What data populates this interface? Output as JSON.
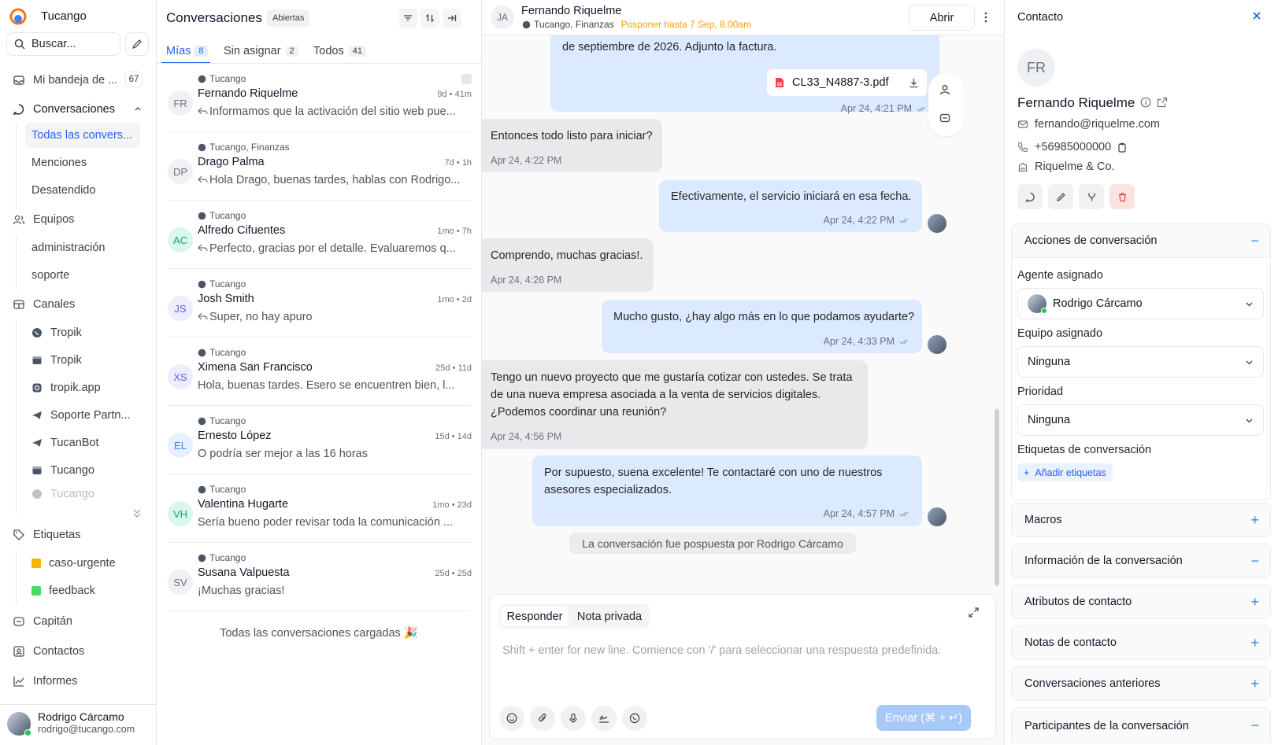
{
  "sidebar": {
    "brand": "Tucango",
    "search_placeholder": "Buscar...",
    "inbox": {
      "label": "Mi bandeja de ...",
      "count": "67"
    },
    "conversations": {
      "label": "Conversaciones",
      "items": [
        "Todas las convers...",
        "Menciones",
        "Desatendido"
      ]
    },
    "teams": {
      "label": "Equipos",
      "items": [
        "administración",
        "soporte"
      ]
    },
    "channels": {
      "label": "Canales",
      "items": [
        "Tropik",
        "Tropik",
        "tropik.app",
        "Soporte Partn...",
        "TucanBot",
        "Tucango",
        "Tucango"
      ]
    },
    "labels": {
      "label": "Etiquetas",
      "items": [
        {
          "name": "caso-urgente",
          "color": "#f5b400"
        },
        {
          "name": "feedback",
          "color": "#4cd964"
        }
      ]
    },
    "captain": "Capitán",
    "contacts": "Contactos",
    "reports": "Informes",
    "user": {
      "name": "Rodrigo Cárcamo",
      "email": "rodrigo@tucango.com"
    }
  },
  "list": {
    "title": "Conversaciones",
    "status_badge": "Abiertas",
    "tabs": [
      {
        "label": "Mías",
        "count": "8"
      },
      {
        "label": "Sin asignar",
        "count": "2"
      },
      {
        "label": "Todos",
        "count": "41"
      }
    ],
    "conversations": [
      {
        "initials": "FR",
        "inbox": "Tucango",
        "name": "Fernando Riquelme",
        "time": "9d • 41m",
        "preview": "Informamos que la activación del sitio web pue...",
        "reply": true,
        "avatar_bg": "#f1f1f3",
        "avatar_fg": "#6b7280"
      },
      {
        "initials": "DP",
        "inbox": "Tucango, Finanzas",
        "name": "Drago Palma",
        "time": "7d • 1h",
        "preview": "Hola Drago, buenas tardes, hablas con Rodrigo...",
        "reply": true,
        "avatar_bg": "#f1f1f3",
        "avatar_fg": "#6b7280"
      },
      {
        "initials": "AC",
        "inbox": "Tucango",
        "name": "Alfredo Cifuentes",
        "time": "1mo • 7h",
        "preview": "Perfecto, gracias por el detalle. Evaluaremos q...",
        "reply": true,
        "avatar_bg": "#d9f7ec",
        "avatar_fg": "#16a37b"
      },
      {
        "initials": "JS",
        "inbox": "Tucango",
        "name": "Josh Smith",
        "time": "1mo • 2d",
        "preview": "Super, no hay apuro",
        "reply": true,
        "avatar_bg": "#eceefe",
        "avatar_fg": "#5b63d3"
      },
      {
        "initials": "XS",
        "inbox": "Tucango",
        "name": "Ximena San Francisco",
        "time": "25d • 11d",
        "preview": "Hola, buenas tardes. Esero se encuentren bien, l...",
        "reply": false,
        "avatar_bg": "#eceefe",
        "avatar_fg": "#5b63d3"
      },
      {
        "initials": "EL",
        "inbox": "Tucango",
        "name": "Ernesto López",
        "time": "15d • 14d",
        "preview": "O podría ser mejor a las 16 horas",
        "reply": false,
        "avatar_bg": "#e6f0fe",
        "avatar_fg": "#3b82f6"
      },
      {
        "initials": "VH",
        "inbox": "Tucango",
        "name": "Valentina Hugarte",
        "time": "1mo • 23d",
        "preview": "Sería bueno poder revisar toda la comunicación ...",
        "reply": false,
        "avatar_bg": "#d9f7ec",
        "avatar_fg": "#16a37b"
      },
      {
        "initials": "SV",
        "inbox": "Tucango",
        "name": "Susana Valpuesta",
        "time": "25d • 25d",
        "preview": "¡Muchas gracias!",
        "reply": false,
        "avatar_bg": "#f1f1f3",
        "avatar_fg": "#6b7280"
      }
    ],
    "footer": "Todas las conversaciones cargadas 🎉"
  },
  "main": {
    "header": {
      "initials": "JA",
      "name": "Fernando Riquelme",
      "inbox": "Tucango, Finanzas",
      "snooze": "Posponer hasta 7 Sep, 8.00am",
      "open_button": "Abrir"
    },
    "messages": {
      "m0_text": "de septiembre de 2026. Adjunto la factura.",
      "attachment": "CL33_N4887-3.pdf",
      "m0_time": "Apr 24, 4:21 PM",
      "m1_text": "Entonces todo listo para iniciar?",
      "m1_time": "Apr 24, 4:22 PM",
      "m2_text": "Efectivamente, el servicio iniciará en esa fecha.",
      "m2_time": "Apr 24, 4:22 PM",
      "m3_text": "Comprendo, muchas gracias!.",
      "m3_time": "Apr 24, 4:26 PM",
      "m4_text": "Mucho gusto, ¿hay algo más en lo que podamos ayudarte?",
      "m4_time": "Apr 24, 4:33 PM",
      "m5_l1": "Tengo un nuevo proyecto que me gustaría cotizar con ustedes. Se trata",
      "m5_l2": "de una nueva empresa asociada a la venta de servicios digitales.",
      "m5_l3": "¿Podemos coordinar una reunión?",
      "m5_time": "Apr 24, 4:56 PM",
      "m6_l1": "Por supuesto, suena excelente! Te contactaré con uno de nuestros",
      "m6_l2": "asesores especializados.",
      "m6_time": "Apr 24, 4:57 PM",
      "activity": "La conversación fue pospuesta por Rodrigo Cárcamo"
    },
    "composer": {
      "tab_reply": "Responder",
      "tab_note": "Nota privada",
      "placeholder": "Shift + enter for new line. Comience con '/' para seleccionar una respuesta predefinida.",
      "send": "Enviar (⌘ + ↵)"
    }
  },
  "panel": {
    "title": "Contacto",
    "contact": {
      "initials": "FR",
      "name": "Fernando Riquelme",
      "email": "fernando@riquelme.com",
      "phone": "+56985000000",
      "company": "Riquelme & Co."
    },
    "actions": {
      "title": "Acciones de conversación",
      "agent_label": "Agente asignado",
      "agent_value": "Rodrigo Cárcamo",
      "team_label": "Equipo asignado",
      "team_value": "Ninguna",
      "priority_label": "Prioridad",
      "priority_value": "Ninguna",
      "labels_label": "Etiquetas de conversación",
      "add_labels": "Añadir etiquetas"
    },
    "sections": [
      "Macros",
      "Información de la conversación",
      "Atributos de contacto",
      "Notas de contacto",
      "Conversaciones anteriores",
      "Participantes de la conversación"
    ],
    "section_signs": [
      "+",
      "−",
      "+",
      "+",
      "+",
      "−"
    ]
  },
  "colors": {
    "accent": "#2563eb",
    "snooze": "#f59e0b",
    "outgoing": "#dbeafe",
    "incoming": "#e9e9ec"
  }
}
